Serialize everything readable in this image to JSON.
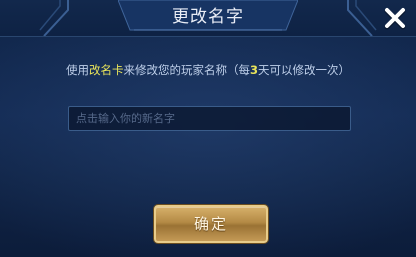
{
  "dialog": {
    "title": "更改名字",
    "close_icon": "close-icon"
  },
  "hint": {
    "part1": "使用",
    "item_name": "改名卡",
    "part2": "来修改您的玩家名称（每",
    "days": "3",
    "part3": "天可以修改一次）"
  },
  "name_input": {
    "value": "",
    "placeholder": "点击输入你的新名字"
  },
  "confirm_button": {
    "label": "确定"
  },
  "colors": {
    "background": "#132a52",
    "highlight": "#e9e45a",
    "button_gold": "#b48a45",
    "text": "#bfd0ea"
  }
}
